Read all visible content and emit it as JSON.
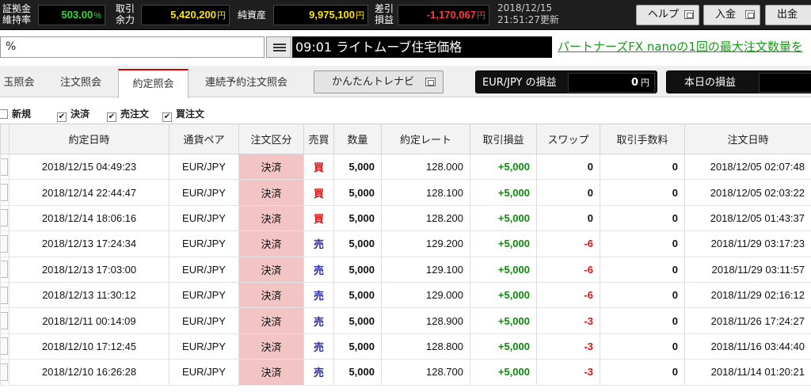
{
  "status": {
    "margin_ratio_label": "証拠金\n維持率",
    "margin_ratio_value": "503.00",
    "margin_ratio_unit": "%",
    "margin_ratio_color": "#33dd33",
    "available_label": "取引\n余力",
    "available_value": "5,420,200",
    "available_unit": "円",
    "available_color": "#ffe800",
    "equity_label": "純資産",
    "equity_value": "9,975,100",
    "equity_unit": "円",
    "equity_color": "#ffe800",
    "pnl_label": "差引\n損益",
    "pnl_value": "-1,170,067",
    "pnl_unit": "円",
    "pnl_color": "#ff3b3b",
    "date": "2018/12/15",
    "updated": "21:51:27更新"
  },
  "top_buttons": {
    "help": "ヘルプ",
    "deposit": "入金",
    "withdraw": "出金"
  },
  "ticker": {
    "left_text": "%",
    "news": "09:01 ライトムーブ住宅価格",
    "link": "パートナーズFX nanoの1回の最大注文数量を"
  },
  "tabs": [
    {
      "label": "玉照会",
      "active": false
    },
    {
      "label": "注文照会",
      "active": false
    },
    {
      "label": "約定照会",
      "active": true
    },
    {
      "label": "連続予約注文照会",
      "active": false
    }
  ],
  "easy_trade_label": "かんたんトレナビ",
  "pnl_boxes": {
    "pair_label": "EUR/JPY の損益",
    "pair_value": "0",
    "pair_unit": "円",
    "today_label": "本日の損益"
  },
  "filters": [
    {
      "label": "新規",
      "checked": false
    },
    {
      "label": "決済",
      "checked": true
    },
    {
      "label": "売注文",
      "checked": true
    },
    {
      "label": "買注文",
      "checked": true
    }
  ],
  "table": {
    "headers": [
      "",
      "約定日時",
      "通貨ペア",
      "注文区分",
      "売買",
      "数量",
      "約定レート",
      "取引損益",
      "スワップ",
      "取引手数料",
      "注文日時"
    ],
    "rows": [
      {
        "datetime": "2018/12/15 04:49:23",
        "pair": "EUR/JPY",
        "kind": "決済",
        "side": "買",
        "qty": "5,000",
        "rate": "128.000",
        "pnl": "+5,000",
        "swap": "0",
        "fee": "0",
        "order_time": "2018/12/05 02:07:48"
      },
      {
        "datetime": "2018/12/14 22:44:47",
        "pair": "EUR/JPY",
        "kind": "決済",
        "side": "買",
        "qty": "5,000",
        "rate": "128.100",
        "pnl": "+5,000",
        "swap": "0",
        "fee": "0",
        "order_time": "2018/12/05 02:03:22"
      },
      {
        "datetime": "2018/12/14 18:06:16",
        "pair": "EUR/JPY",
        "kind": "決済",
        "side": "買",
        "qty": "5,000",
        "rate": "128.200",
        "pnl": "+5,000",
        "swap": "0",
        "fee": "0",
        "order_time": "2018/12/05 01:43:37"
      },
      {
        "datetime": "2018/12/13 17:24:34",
        "pair": "EUR/JPY",
        "kind": "決済",
        "side": "売",
        "qty": "5,000",
        "rate": "129.200",
        "pnl": "+5,000",
        "swap": "-6",
        "fee": "0",
        "order_time": "2018/11/29 03:17:23"
      },
      {
        "datetime": "2018/12/13 17:03:00",
        "pair": "EUR/JPY",
        "kind": "決済",
        "side": "売",
        "qty": "5,000",
        "rate": "129.100",
        "pnl": "+5,000",
        "swap": "-6",
        "fee": "0",
        "order_time": "2018/11/29 03:11:57"
      },
      {
        "datetime": "2018/12/13 11:30:12",
        "pair": "EUR/JPY",
        "kind": "決済",
        "side": "売",
        "qty": "5,000",
        "rate": "129.000",
        "pnl": "+5,000",
        "swap": "-6",
        "fee": "0",
        "order_time": "2018/11/29 02:16:12"
      },
      {
        "datetime": "2018/12/11 00:14:09",
        "pair": "EUR/JPY",
        "kind": "決済",
        "side": "売",
        "qty": "5,000",
        "rate": "128.900",
        "pnl": "+5,000",
        "swap": "-3",
        "fee": "0",
        "order_time": "2018/11/26 17:24:27"
      },
      {
        "datetime": "2018/12/10 17:12:45",
        "pair": "EUR/JPY",
        "kind": "決済",
        "side": "売",
        "qty": "5,000",
        "rate": "128.800",
        "pnl": "+5,000",
        "swap": "-3",
        "fee": "0",
        "order_time": "2018/11/16 03:44:40"
      },
      {
        "datetime": "2018/12/10 16:26:28",
        "pair": "EUR/JPY",
        "kind": "決済",
        "side": "売",
        "qty": "5,000",
        "rate": "128.700",
        "pnl": "+5,000",
        "swap": "-3",
        "fee": "0",
        "order_time": "2018/11/14 01:20:21"
      }
    ]
  },
  "colors": {
    "buy": "#e01010",
    "sell": "#2a2aa8",
    "profit": "#0a8a0a",
    "kind_bg": "#f2c4c4",
    "active_tab_accent": "#dd0000"
  }
}
